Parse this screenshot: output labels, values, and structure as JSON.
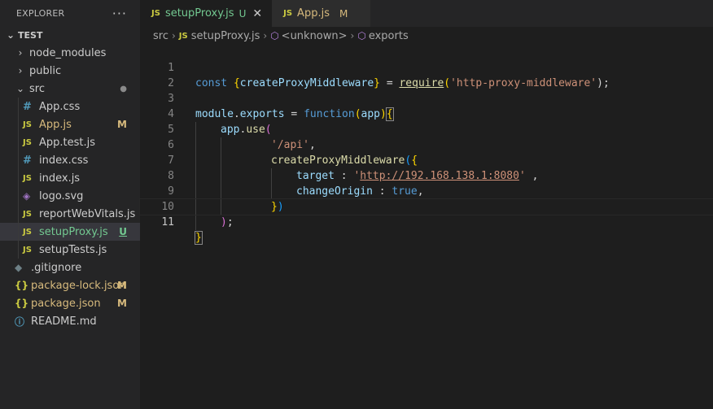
{
  "explorer": {
    "title": "EXPLORER",
    "more": "···",
    "folder": "TEST",
    "items": [
      {
        "label": "node_modules",
        "kind": "folder",
        "depth": 1,
        "chev": "›",
        "icon": ""
      },
      {
        "label": "public",
        "kind": "folder",
        "depth": 1,
        "chev": "›",
        "icon": ""
      },
      {
        "label": "src",
        "kind": "folder",
        "depth": 1,
        "chev": "⌄",
        "icon": "",
        "badge": "●"
      },
      {
        "label": "App.css",
        "kind": "file",
        "depth": 2,
        "icon": "#"
      },
      {
        "label": "App.js",
        "kind": "file",
        "depth": 2,
        "icon": "JS",
        "badge": "M"
      },
      {
        "label": "App.test.js",
        "kind": "file",
        "depth": 2,
        "icon": "JS"
      },
      {
        "label": "index.css",
        "kind": "file",
        "depth": 2,
        "icon": "#"
      },
      {
        "label": "index.js",
        "kind": "file",
        "depth": 2,
        "icon": "JS"
      },
      {
        "label": "logo.svg",
        "kind": "file",
        "depth": 2,
        "icon": "◈"
      },
      {
        "label": "reportWebVitals.js",
        "kind": "file",
        "depth": 2,
        "icon": "JS"
      },
      {
        "label": "setupProxy.js",
        "kind": "file",
        "depth": 2,
        "icon": "JS",
        "badge": "U"
      },
      {
        "label": "setupTests.js",
        "kind": "file",
        "depth": 2,
        "icon": "JS"
      },
      {
        "label": ".gitignore",
        "kind": "file",
        "depth": 1,
        "icon": "◆"
      },
      {
        "label": "package-lock.json",
        "kind": "file",
        "depth": 1,
        "icon": "{}",
        "badge": "M"
      },
      {
        "label": "package.json",
        "kind": "file",
        "depth": 1,
        "icon": "{}",
        "badge": "M"
      },
      {
        "label": "README.md",
        "kind": "file",
        "depth": 1,
        "icon": "ⓘ"
      }
    ]
  },
  "tabs": [
    {
      "icon": "JS",
      "label": "setupProxy.js",
      "badge": "U",
      "close": "✕"
    },
    {
      "icon": "JS",
      "label": "App.js",
      "badge": "M"
    }
  ],
  "breadcrumb": {
    "folder": "src",
    "file_icon": "JS",
    "file": "setupProxy.js",
    "symbol1": "<unknown>",
    "symbol2": "exports",
    "sep": "›"
  },
  "code": {
    "line_numbers": [
      "1",
      "2",
      "3",
      "4",
      "5",
      "6",
      "7",
      "8",
      "9",
      "10",
      "11"
    ],
    "l1": {
      "kw": "const",
      "sp": " ",
      "ob": "{",
      "id": "createProxyMiddleware",
      "cb": "}",
      "eq": " = ",
      "req": "require",
      "op": "(",
      "str": "'http-proxy-middleware'",
      "end": ");"
    },
    "l3": {
      "mod": "module",
      "dot": ".",
      "exp": "exports",
      "eq": " = ",
      "fn": "function",
      "op": "(",
      "arg": "app",
      "cp": ")",
      "ob": "{"
    },
    "l4": {
      "app": "app",
      "dot": ".",
      "use": "use",
      "op": "("
    },
    "l5": {
      "str": "'/api'",
      "comma": ","
    },
    "l6": {
      "fn": "createProxyMiddleware",
      "op": "(",
      "ob": "{"
    },
    "l7": {
      "key": "target",
      "colon": " : ",
      "q1": "'",
      "url": "http://192.168.138.1:8080",
      "q2": "'",
      "comma": " ,"
    },
    "l8": {
      "key": "changeOrigin",
      "colon": " : ",
      "val": "true",
      "comma": ","
    },
    "l9": {
      "cb": "}",
      "cp": ")"
    },
    "l10": {
      "cp": ")",
      "semi": ";"
    },
    "l11": {
      "cb": "}"
    }
  },
  "colors": {
    "accent_modified": "#d7ba7d",
    "accent_untracked": "#73c991",
    "js_icon": "#cbcb41"
  }
}
